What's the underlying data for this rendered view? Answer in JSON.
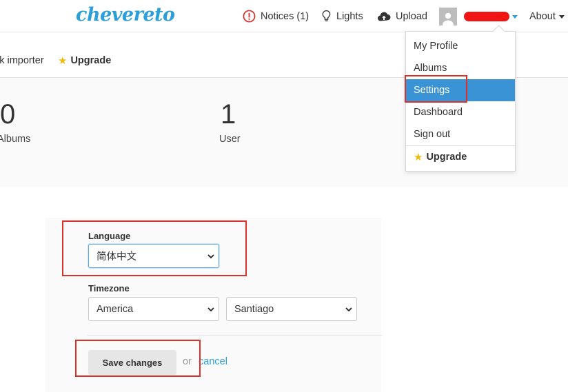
{
  "header": {
    "logo": "chevereto",
    "notices_label": "Notices (1)",
    "lights_label": "Lights",
    "upload_label": "Upload",
    "about_label": "About"
  },
  "subnav": {
    "bulk_importer_label": "lk importer",
    "upgrade_label": "Upgrade"
  },
  "stats": [
    {
      "value": "0",
      "label": "Albums"
    },
    {
      "value": "1",
      "label": "User"
    }
  ],
  "form": {
    "language_label": "Language",
    "language_value": "简体中文",
    "timezone_label": "Timezone",
    "timezone_region": "America",
    "timezone_city": "Santiago",
    "save_label": "Save changes",
    "or_text": "or",
    "cancel_label": "cancel"
  },
  "user_menu": {
    "items": [
      "My Profile",
      "Albums",
      "Settings",
      "Dashboard",
      "Sign out"
    ],
    "active_item": "Settings",
    "upgrade_label": "Upgrade"
  },
  "colors": {
    "brand": "#2c9fd8",
    "active_menu": "#3a93d4",
    "star": "#f0b90b",
    "annotation": "#d9322b",
    "notice_icon": "#d9322b"
  }
}
